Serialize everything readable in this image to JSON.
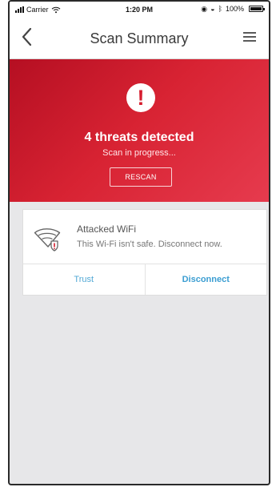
{
  "status_bar": {
    "carrier": "Carrier",
    "time": "1:20 PM",
    "battery": "100%",
    "icons": {
      "signal": "signal-icon",
      "wifi": "wifi-icon",
      "location": "location-icon",
      "lock": "lock-icon",
      "bluetooth": "bluetooth-icon",
      "battery": "battery-icon"
    }
  },
  "header": {
    "title": "Scan Summary",
    "back_icon": "back-chevron-icon",
    "menu_icon": "hamburger-menu-icon"
  },
  "hero": {
    "alert_symbol": "!",
    "threat_count": "4 threats detected",
    "scan_status": "Scan in progress...",
    "rescan_label": "RESCAN",
    "colors": {
      "primary": "#d11f2e",
      "dark": "#b50f22",
      "light": "#e63b4e"
    }
  },
  "threat_card": {
    "title": "Attacked WiFi",
    "description": "This Wi-Fi isn't safe. Disconnect now.",
    "icon": "wifi-warning-icon",
    "actions": {
      "trust_label": "Trust",
      "disconnect_label": "Disconnect"
    },
    "colors": {
      "action_blue": "#3c9ed2",
      "warning_red": "#d61d2e"
    }
  }
}
